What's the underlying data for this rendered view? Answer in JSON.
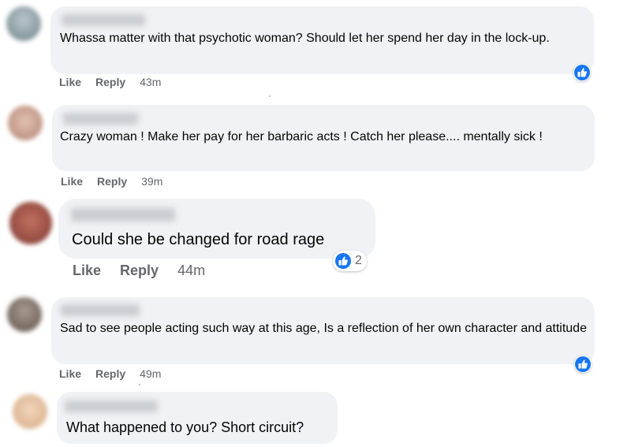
{
  "comments": [
    {
      "text": "Whassa matter with that psychotic woman? Should let her spend her day in the lock-up.",
      "like": "Like",
      "reply": "Reply",
      "time": "43m",
      "avatar_color": "#8a9ba3"
    },
    {
      "text": "Crazy woman ! Make her pay for her barbaric acts ! Catch her please.... mentally sick !",
      "like": "Like",
      "reply": "Reply",
      "time": "39m",
      "avatar_color": "#c79a86"
    },
    {
      "text": "Could she be changed for road rage",
      "like": "Like",
      "reply": "Reply",
      "time": "44m",
      "reaction_count": "2",
      "avatar_color": "#a0544a"
    },
    {
      "text": "Sad to see people acting such way at this age, Is a reflection of her own character and attitude",
      "like": "Like",
      "reply": "Reply",
      "time": "49m",
      "avatar_color": "#7d6f66"
    },
    {
      "text": "What happened to you? Short circuit?",
      "avatar_color": "#e6c3a2"
    }
  ],
  "colors": {
    "bubble": "#f0f2f5",
    "meta_text": "#65676b",
    "like_blue": "#1877f2"
  },
  "icons": [
    "like-thumb-icon"
  ]
}
